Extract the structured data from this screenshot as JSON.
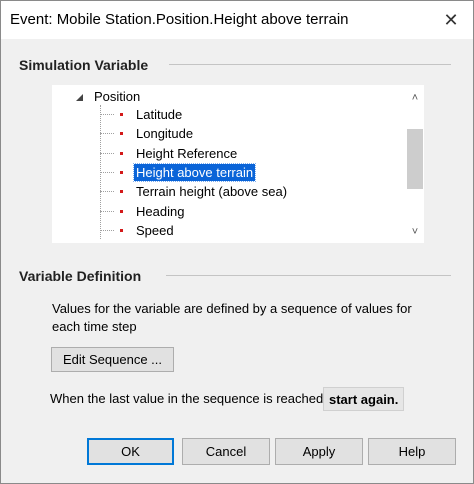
{
  "window": {
    "title": "Event: Mobile Station.Position.Height above terrain",
    "close_glyph": "✕"
  },
  "simulation_variable": {
    "header": "Simulation Variable",
    "tree": {
      "root_label": "Position",
      "items": [
        {
          "label": "Latitude",
          "selected": false
        },
        {
          "label": "Longitude",
          "selected": false
        },
        {
          "label": "Height Reference",
          "selected": false
        },
        {
          "label": "Height above terrain",
          "selected": true
        },
        {
          "label": "Terrain height (above sea)",
          "selected": false
        },
        {
          "label": "Heading",
          "selected": false
        },
        {
          "label": "Speed",
          "selected": false
        }
      ]
    },
    "scroll_up_glyph": "˄",
    "scroll_down_glyph": "˅"
  },
  "variable_definition": {
    "header": "Variable Definition",
    "description": "Values for the variable are defined by a sequence of values for each time step",
    "edit_sequence_label": "Edit Sequence ...",
    "last_value_text": "When the last value in the sequence is reached,",
    "start_again_label": "start again."
  },
  "buttons": {
    "ok": "OK",
    "cancel": "Cancel",
    "apply": "Apply",
    "help": "Help"
  },
  "colors": {
    "selection": "#0a64d8",
    "bullet": "#d31a1a",
    "default_button_border": "#0078d7"
  }
}
